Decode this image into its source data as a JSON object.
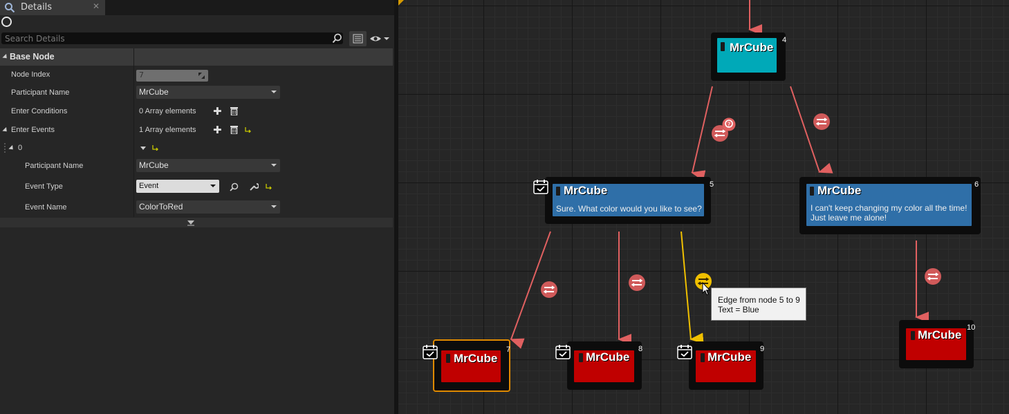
{
  "tab": {
    "title": "Details",
    "close": "✕"
  },
  "search": {
    "placeholder": "Search Details"
  },
  "sections": {
    "base_node": "Base Node"
  },
  "props": {
    "node_index_label": "Node Index",
    "node_index_value": "7",
    "participant_name_label": "Participant Name",
    "participant_name_value": "MrCube",
    "enter_conditions_label": "Enter Conditions",
    "enter_conditions_value": "0 Array elements",
    "enter_events_label": "Enter Events",
    "enter_events_value": "1 Array elements",
    "element_index": "0",
    "event_participant_label": "Participant Name",
    "event_participant_value": "MrCube",
    "event_type_label": "Event Type",
    "event_type_value": "Event",
    "event_name_label": "Event Name",
    "event_name_value": "ColorToRed"
  },
  "graph": {
    "nodes": [
      {
        "id": "4",
        "participant": "MrCube",
        "text": "",
        "color": "#00a9b8"
      },
      {
        "id": "5",
        "participant": "MrCube",
        "text": "Sure. What color would you like to see?",
        "color": "#2f6fa8"
      },
      {
        "id": "6",
        "participant": "MrCube",
        "text_lines": [
          "I can't keep changing my color all the time!",
          "Just leave me alone!"
        ],
        "color": "#2f6fa8"
      },
      {
        "id": "7",
        "participant": "MrCube",
        "text": "",
        "color": "#c00000",
        "selected": true
      },
      {
        "id": "8",
        "participant": "MrCube",
        "text": "",
        "color": "#c00000"
      },
      {
        "id": "9",
        "participant": "MrCube",
        "text": "",
        "color": "#c00000"
      },
      {
        "id": "10",
        "participant": "MrCube",
        "text": "",
        "color": "#c00000"
      }
    ],
    "tooltip": {
      "line1": "Edge from node 5 to 9",
      "line2": "Text = Blue"
    },
    "colors": {
      "edge": "#e06060",
      "edge_highlight": "#f0c000",
      "selection": "#e08a00"
    }
  }
}
